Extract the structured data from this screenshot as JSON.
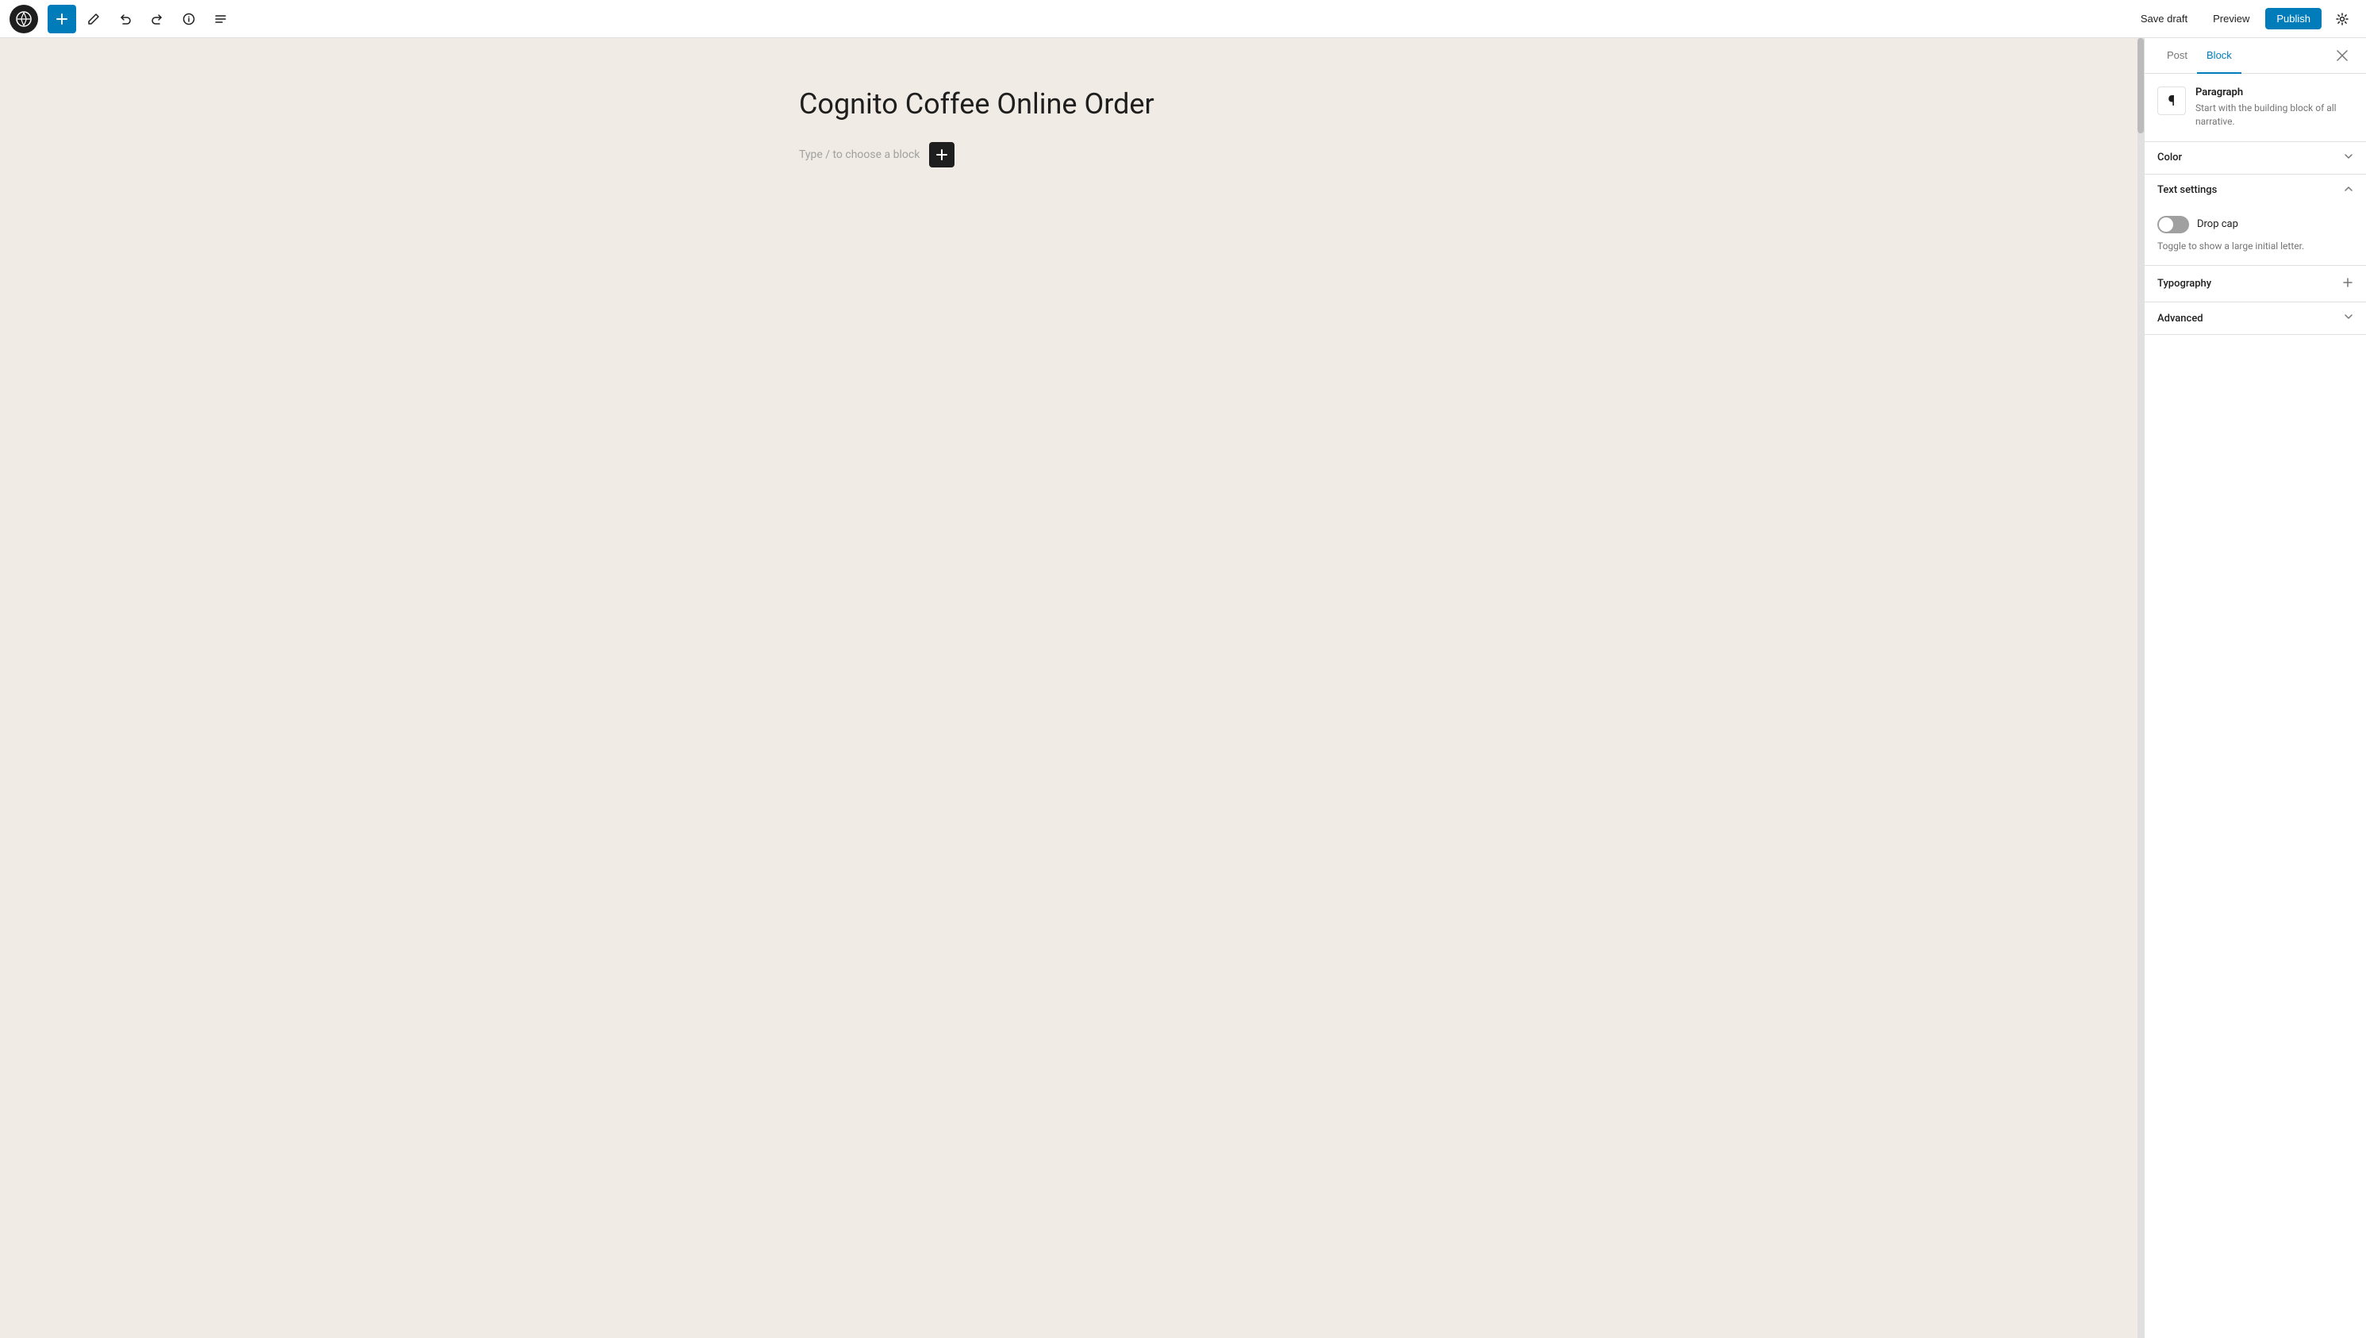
{
  "toolbar": {
    "add_label": "+",
    "save_draft_label": "Save draft",
    "preview_label": "Preview",
    "publish_label": "Publish"
  },
  "editor": {
    "post_title": "Cognito Coffee Online Order",
    "block_placeholder": "Type / to choose a block"
  },
  "sidebar": {
    "tab_post_label": "Post",
    "tab_block_label": "Block",
    "active_tab": "Block",
    "block_info": {
      "title": "Paragraph",
      "description": "Start with the building block of all narrative."
    },
    "panels": {
      "color": {
        "title": "Color",
        "expanded": false
      },
      "text_settings": {
        "title": "Text settings",
        "expanded": true,
        "drop_cap_label": "Drop cap",
        "drop_cap_desc": "Toggle to show a large initial letter.",
        "drop_cap_on": false
      },
      "typography": {
        "title": "Typography",
        "expanded": false
      },
      "advanced": {
        "title": "Advanced",
        "expanded": false
      }
    }
  }
}
